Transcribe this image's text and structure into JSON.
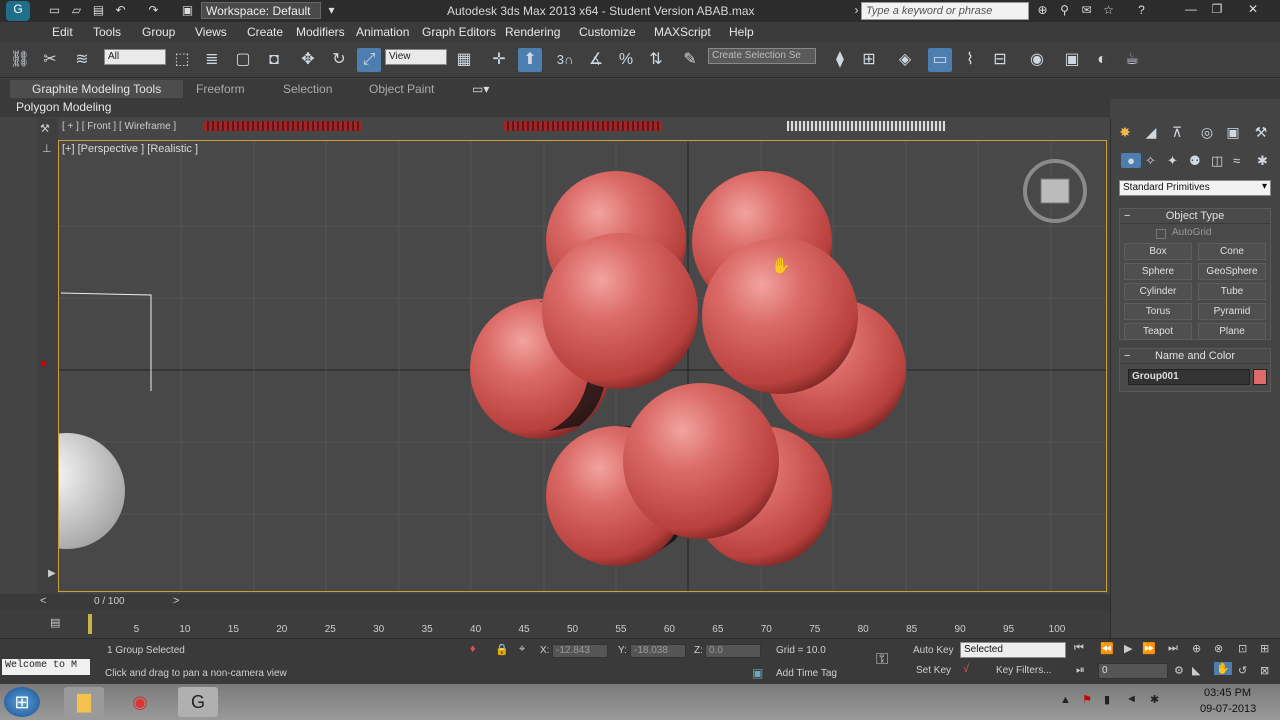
{
  "window": {
    "title": "Autodesk 3ds Max  2013 x64  - Student Version   ABAB.max",
    "workspace": "Workspace: Default",
    "search_placeholder": "Type a keyword or phrase"
  },
  "menu": [
    "Edit",
    "Tools",
    "Group",
    "Views",
    "Create",
    "Modifiers",
    "Animation",
    "Graph Editors",
    "Rendering",
    "Customize",
    "MAXScript",
    "Help"
  ],
  "toolbar": {
    "selection_filter": "All",
    "ref_coord": "View",
    "snap_label": "3",
    "named_selection_placeholder": "Create Selection Se"
  },
  "ribbon": {
    "tabs": [
      "Graphite Modeling Tools",
      "Freeform",
      "Selection",
      "Object Paint"
    ],
    "panel": "Polygon Modeling"
  },
  "viewport": {
    "front_label": "[ + ] [ Front ] [ Wireframe ]",
    "label": "[+] [Perspective ] [Realistic ]"
  },
  "command_panel": {
    "category": "Standard Primitives",
    "object_type_title": "Object Type",
    "autogrid": "AutoGrid",
    "buttons": [
      "Box",
      "Cone",
      "Sphere",
      "GeoSphere",
      "Cylinder",
      "Tube",
      "Torus",
      "Pyramid",
      "Teapot",
      "Plane"
    ],
    "name_color_title": "Name and Color",
    "object_name": "Group001",
    "object_color": "#e06a6a"
  },
  "timeline": {
    "frame_counter": "0 / 100",
    "ticks": [
      "5",
      "10",
      "15",
      "20",
      "25",
      "30",
      "35",
      "40",
      "45",
      "50",
      "55",
      "60",
      "65",
      "70",
      "75",
      "80",
      "85",
      "90",
      "95",
      "100"
    ]
  },
  "status": {
    "selected": "1 Group Selected",
    "prompt": "Click and drag to pan a non-camera view",
    "maxscript": "Welcome to M",
    "x_label": "X:",
    "x_value": "-12.843",
    "y_label": "Y:",
    "y_value": "-18.038",
    "z_label": "Z:",
    "z_value": "0.0",
    "grid": "Grid = 10.0",
    "add_time_tag": "Add Time Tag",
    "auto_key": "Auto Key",
    "set_key": "Set Key",
    "key_mode": "Selected",
    "key_filters": "Key Filters...",
    "frame_field": "0"
  },
  "taskbar": {
    "time": "03:45 PM",
    "date": "09-07-2013"
  },
  "colors": {
    "sphere": "#d9605d",
    "selection_border": "#c9a13c"
  }
}
